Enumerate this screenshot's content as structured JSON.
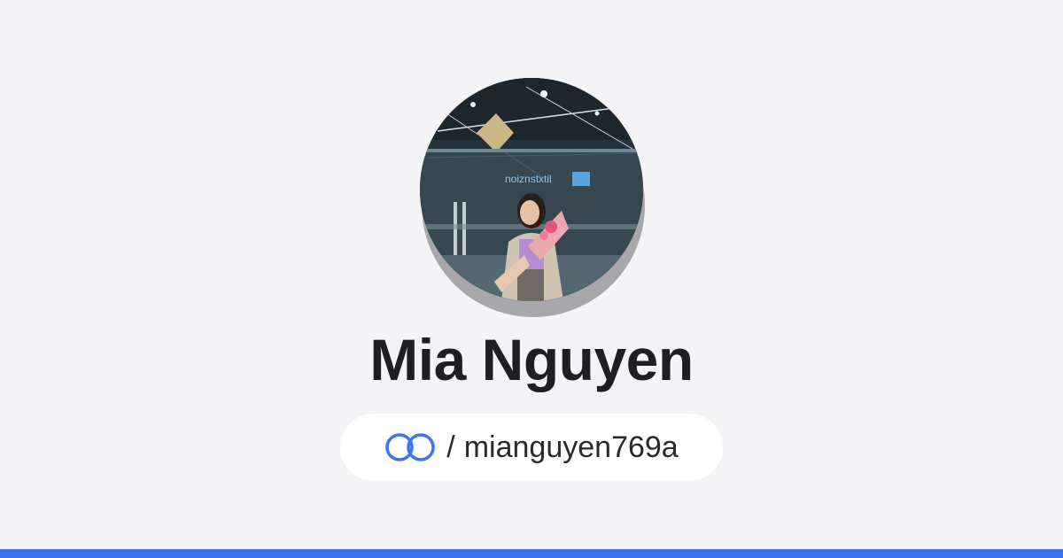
{
  "profile": {
    "name": "Mia Nguyen",
    "separator": "/",
    "username": "mianguyen769a",
    "avatar_icon": "profile-photo"
  },
  "colors": {
    "background": "#f4f4f6",
    "accent": "#3b76f0",
    "pill_background": "#ffffff",
    "text": "#1f1f22"
  },
  "icons": {
    "handle_icon": "link-rings-icon"
  }
}
